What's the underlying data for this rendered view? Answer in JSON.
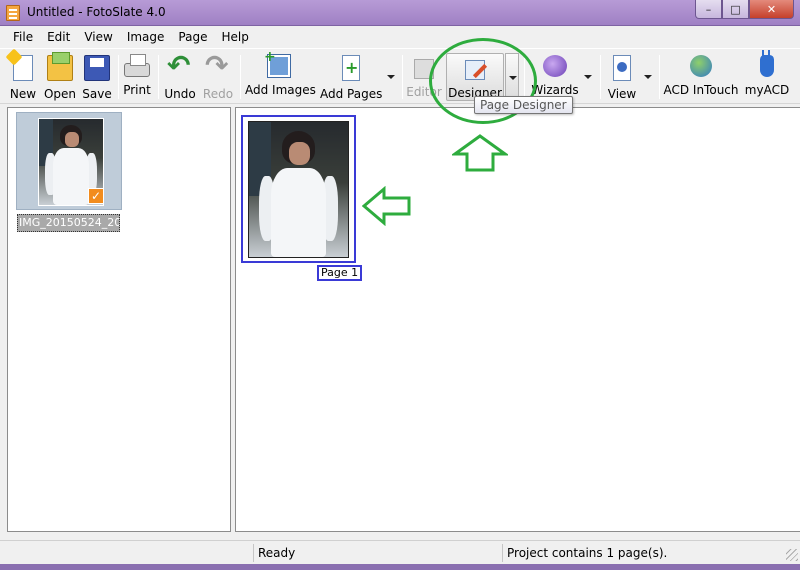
{
  "window": {
    "title": "Untitled - FotoSlate 4.0",
    "minimize_glyph": "–",
    "maximize_glyph": "□",
    "close_glyph": "✕"
  },
  "menu": [
    "File",
    "Edit",
    "View",
    "Image",
    "Page",
    "Help"
  ],
  "toolbar": {
    "new": "New",
    "open": "Open",
    "save": "Save",
    "print": "Print",
    "undo": "Undo",
    "redo": "Redo",
    "add_images": "Add Images",
    "add_pages": "Add Pages",
    "editor": "Editor",
    "designer": "Designer",
    "wizards": "Wizards",
    "view": "View",
    "acd_intouch": "ACD InTouch",
    "myacd": "myACD"
  },
  "tooltip": "Page Designer",
  "image_browser": {
    "items": [
      {
        "caption": "IMG_20150524_20...",
        "checked": true
      }
    ]
  },
  "pages": [
    {
      "label": "Page 1"
    }
  ],
  "status": {
    "state": "Ready",
    "summary": "Project contains 1 page(s)."
  },
  "annotations": {
    "color": "#2eac3e"
  }
}
